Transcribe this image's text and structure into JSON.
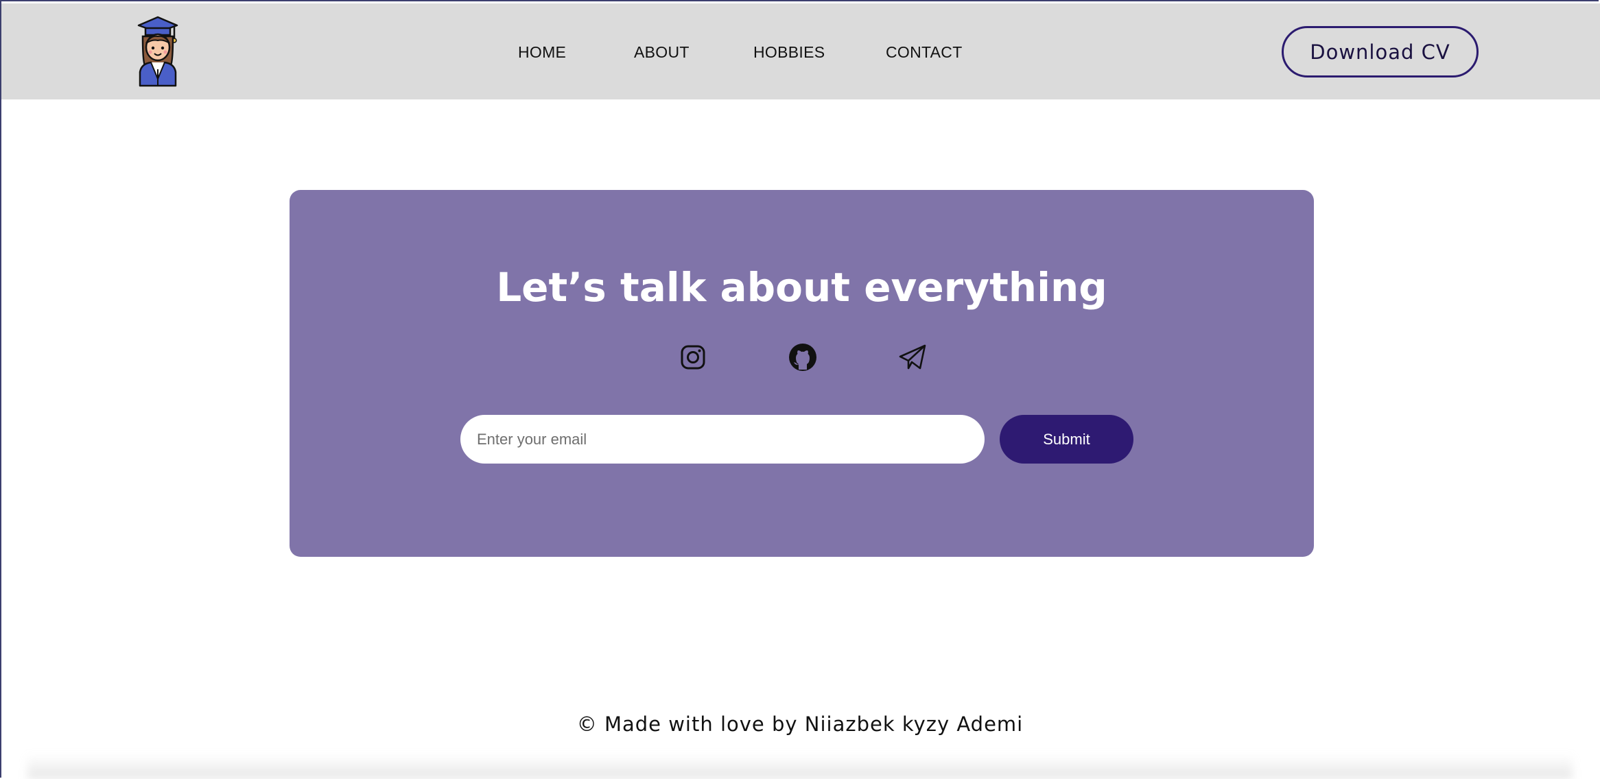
{
  "header": {
    "logo_name": "graduate-avatar-logo",
    "nav": [
      {
        "label": "HOME"
      },
      {
        "label": "ABOUT"
      },
      {
        "label": "HOBBIES"
      },
      {
        "label": "CONTACT"
      }
    ],
    "download_label": "Download CV"
  },
  "contact": {
    "title": "Let’s talk about everything",
    "social_icons": [
      "instagram-icon",
      "github-icon",
      "telegram-icon"
    ],
    "email_placeholder": "Enter your email",
    "email_value": "",
    "submit_label": "Submit"
  },
  "footer": {
    "text": "© Made with love by Niiazbek kyzy Ademi"
  },
  "colors": {
    "header_bg": "#dbdbdb",
    "card_bg": "#8074a9",
    "accent": "#2e1a72",
    "text": "#111111"
  }
}
